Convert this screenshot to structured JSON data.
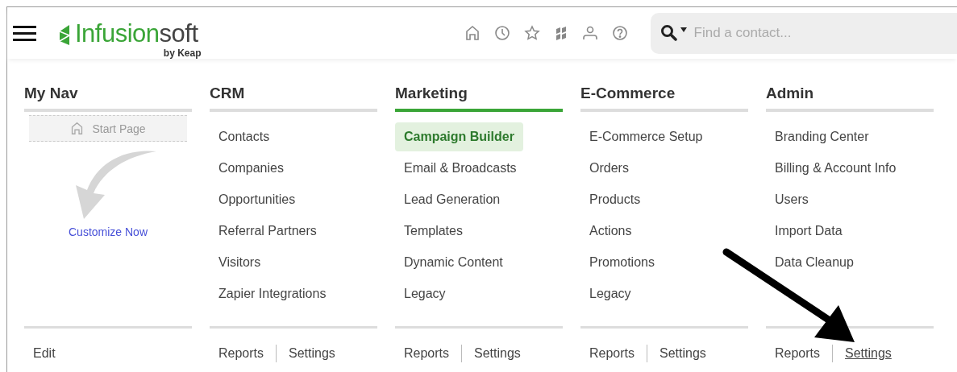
{
  "header": {
    "logo": {
      "brand_strong": "Infusion",
      "brand_light": "soft",
      "byline": "by Keap"
    },
    "search": {
      "placeholder": "Find a contact..."
    }
  },
  "columns": [
    {
      "kind": "mynav",
      "title": "My Nav",
      "selected": false,
      "start_page": "Start Page",
      "customize": "Customize Now",
      "footer_links": [
        {
          "label": "Edit",
          "underlined": false
        }
      ]
    },
    {
      "kind": "menu",
      "title": "CRM",
      "selected": false,
      "items": [
        {
          "label": "Contacts",
          "selected": false
        },
        {
          "label": "Companies",
          "selected": false
        },
        {
          "label": "Opportunities",
          "selected": false
        },
        {
          "label": "Referral Partners",
          "selected": false
        },
        {
          "label": "Visitors",
          "selected": false
        },
        {
          "label": "Zapier Integrations",
          "selected": false
        }
      ],
      "footer_links": [
        {
          "label": "Reports",
          "underlined": false
        },
        {
          "label": "Settings",
          "underlined": false
        }
      ]
    },
    {
      "kind": "menu",
      "title": "Marketing",
      "selected": true,
      "items": [
        {
          "label": "Campaign Builder",
          "selected": true
        },
        {
          "label": "Email & Broadcasts",
          "selected": false
        },
        {
          "label": "Lead Generation",
          "selected": false
        },
        {
          "label": "Templates",
          "selected": false
        },
        {
          "label": "Dynamic Content",
          "selected": false
        },
        {
          "label": "Legacy",
          "selected": false
        }
      ],
      "footer_links": [
        {
          "label": "Reports",
          "underlined": false
        },
        {
          "label": "Settings",
          "underlined": false
        }
      ]
    },
    {
      "kind": "menu",
      "title": "E-Commerce",
      "selected": false,
      "items": [
        {
          "label": "E-Commerce Setup",
          "selected": false
        },
        {
          "label": "Orders",
          "selected": false
        },
        {
          "label": "Products",
          "selected": false
        },
        {
          "label": "Actions",
          "selected": false
        },
        {
          "label": "Promotions",
          "selected": false
        },
        {
          "label": "Legacy",
          "selected": false
        }
      ],
      "footer_links": [
        {
          "label": "Reports",
          "underlined": false
        },
        {
          "label": "Settings",
          "underlined": false
        }
      ]
    },
    {
      "kind": "menu",
      "title": "Admin",
      "selected": false,
      "items": [
        {
          "label": "Branding Center",
          "selected": false
        },
        {
          "label": "Billing & Account Info",
          "selected": false
        },
        {
          "label": "Users",
          "selected": false
        },
        {
          "label": "Import Data",
          "selected": false
        },
        {
          "label": "Data Cleanup",
          "selected": false
        }
      ],
      "footer_links": [
        {
          "label": "Reports",
          "underlined": false
        },
        {
          "label": "Settings",
          "underlined": true
        }
      ]
    }
  ]
}
